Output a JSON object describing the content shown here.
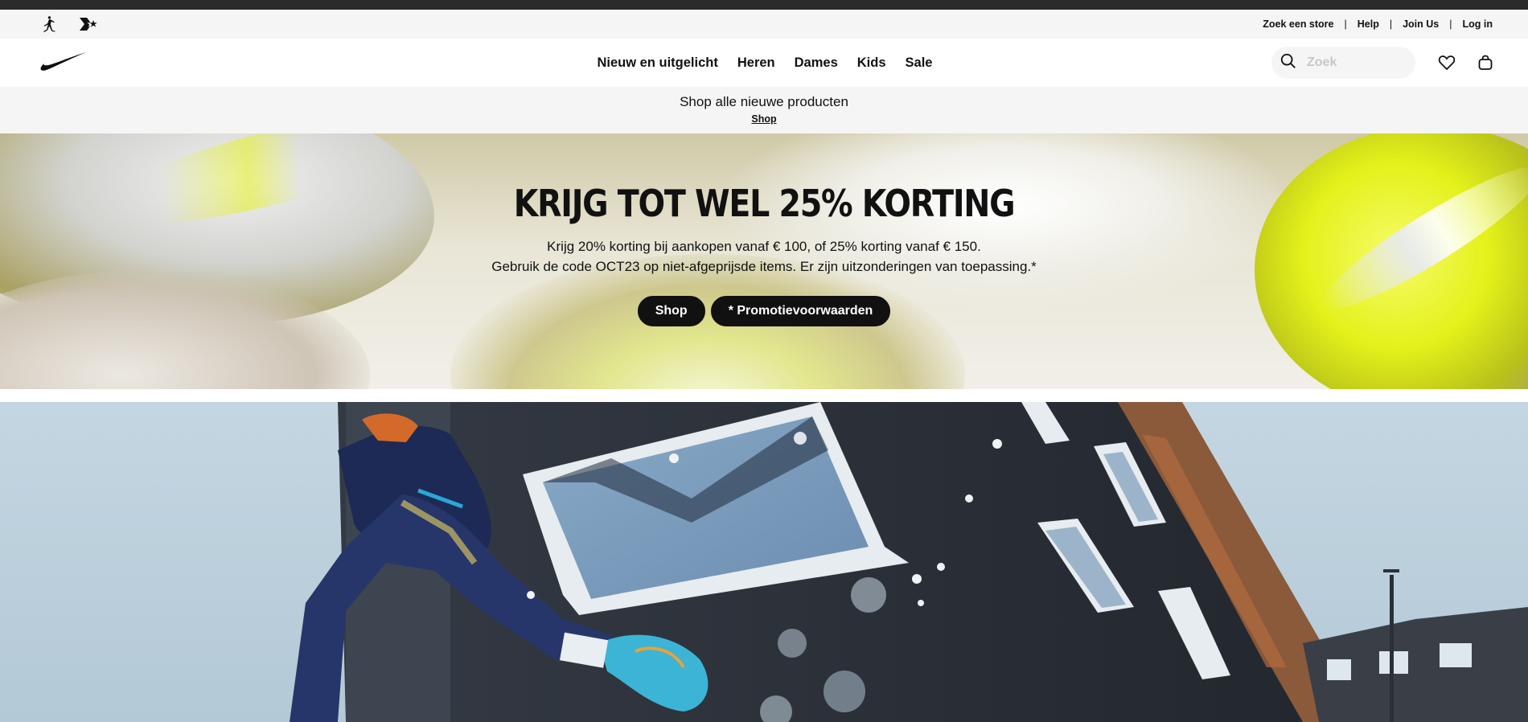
{
  "utility_bar": {
    "links": [
      "Zoek een store",
      "Help",
      "Join Us",
      "Log in"
    ],
    "separator": "|"
  },
  "brand_icons": [
    "jordan-icon",
    "converse-icon"
  ],
  "nav": {
    "logo": "nike-swoosh-icon",
    "items": [
      "Nieuw en uitgelicht",
      "Heren",
      "Dames",
      "Kids",
      "Sale"
    ],
    "search_placeholder": "Zoek",
    "icons": [
      "search-icon",
      "heart-icon",
      "bag-icon"
    ]
  },
  "promo_strip": {
    "text": "Shop alle nieuwe producten",
    "link": "Shop"
  },
  "hero": {
    "title": "KRIJG TOT WEL 25% KORTING",
    "subtitle_line1": "Krijg 20% korting bij aankopen vanaf € 100, of 25% korting vanaf € 150.",
    "subtitle_line2": "Gebruik de code OCT23 op niet-afgeprijsde items. Er zijn uitzonderingen van toepassing.*",
    "buttons": [
      "Shop",
      "* Promotievoorwaarden"
    ]
  },
  "colors": {
    "text": "#111111",
    "utility_bg": "#f5f5f5",
    "hero_olive": "#a9a061",
    "hero_yellow": "#e5f21a"
  }
}
